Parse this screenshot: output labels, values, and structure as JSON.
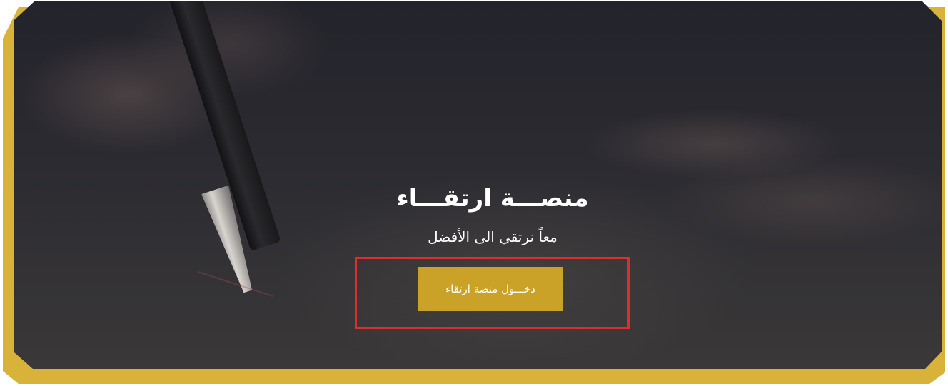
{
  "hero": {
    "title": "منصـــة ارتقـــاء",
    "subtitle": "معاً نرتقي الى الأفضل",
    "login_button_label": "دخـــول منصة ارتقاء"
  },
  "colors": {
    "frame_accent": "#d9b23a",
    "button_background": "#c9a227",
    "highlight_border": "#e02c2c",
    "text": "#ffffff"
  }
}
